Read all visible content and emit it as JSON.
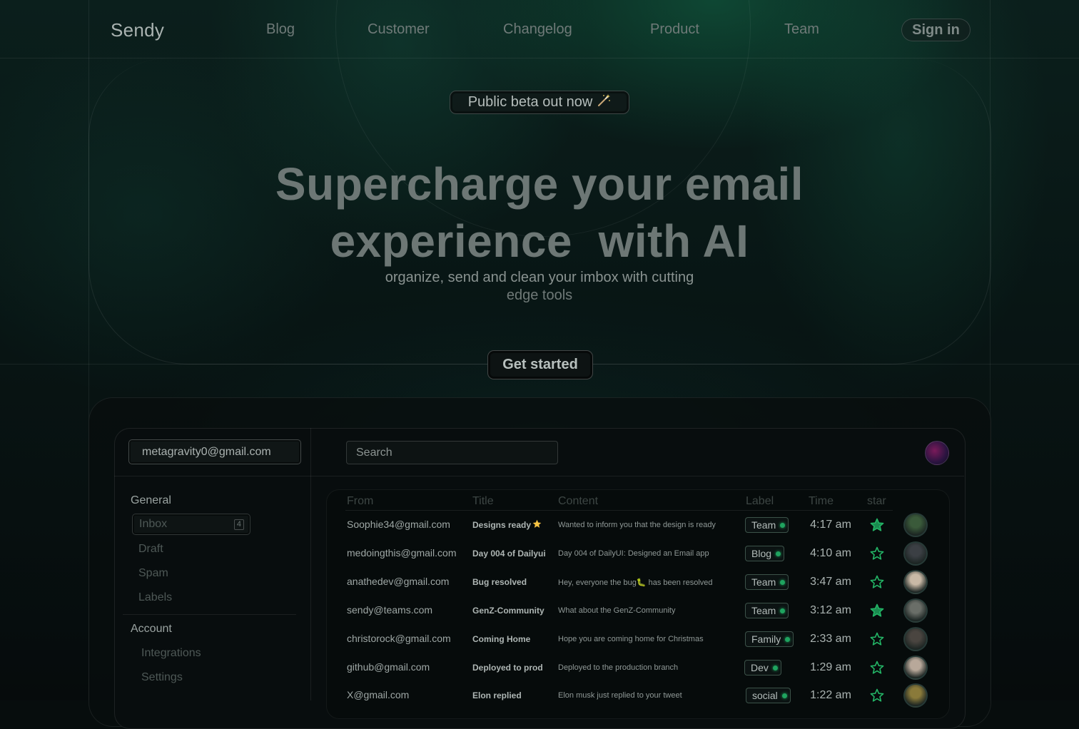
{
  "nav": {
    "brand": "Sendy",
    "links": [
      "Blog",
      "Customer",
      "Changelog",
      "Product",
      "Team"
    ],
    "signin": "Sign in"
  },
  "hero": {
    "pill_text": "Public beta out now",
    "pill_icon": "magic-wand-icon",
    "headline_line1": "Supercharge your email",
    "headline_line2": "experience  with AI",
    "subline_line1": "organize, send and clean your imbox with cutting",
    "subline_line2": "edge tools",
    "cta": "Get started"
  },
  "app": {
    "account_email": "metagravity0@gmail.com",
    "search_placeholder": "Search",
    "sidebar": {
      "general_title": "General",
      "inbox_label": "Inbox",
      "inbox_count": "4",
      "items": [
        "Draft",
        "Spam",
        "Labels"
      ],
      "account_title": "Account",
      "account_items": [
        "Integrations",
        "Settings"
      ]
    },
    "table": {
      "headers": [
        "From",
        "Title",
        "Content",
        "Label",
        "Time",
        "star"
      ],
      "rows": [
        {
          "from": "Soophie34@gmail.com",
          "title": "Designs ready",
          "title_icon": "star-emoji",
          "content": "Wanted to inform you that the design is ready",
          "label": "Team",
          "time": "4:17 am",
          "starred": true,
          "avatar_color": "#3a5a3a"
        },
        {
          "from": "medoingthis@gmail.com",
          "title": "Day 004 of Dailyui",
          "content": "Day 004 of DailyUI: Designed an Email app",
          "label": "Blog",
          "time": "4:10 am",
          "starred": false,
          "avatar_color": "#3b3f44"
        },
        {
          "from": "anathedev@gmail.com",
          "title": "Bug resolved",
          "content": "Hey,  everyone the bug🐛 has been resolved",
          "label": "Team",
          "time": "3:47 am",
          "starred": false,
          "avatar_color": "#c9b9a6"
        },
        {
          "from": "sendy@teams.com",
          "title": "GenZ-Community",
          "content": "What about the GenZ-Community",
          "label": "Team",
          "time": "3:12 am",
          "starred": true,
          "avatar_color": "#6a6e68"
        },
        {
          "from": "christorock@gmail.com",
          "title": "Coming Home",
          "content": "Hope you are coming home for Christmas",
          "label": "Family",
          "time": "2:33 am",
          "starred": false,
          "avatar_color": "#4a4540"
        },
        {
          "from": "github@gmail.com",
          "title": "Deployed to prod",
          "content": "Deployed to the production branch",
          "label": "Dev",
          "time": "1:29 am",
          "starred": false,
          "avatar_color": "#b8a89a"
        },
        {
          "from": "X@gmail.com",
          "title": "Elon replied",
          "content": "Elon musk just replied to your tweet",
          "label": "social",
          "time": "1:22 am",
          "starred": false,
          "avatar_color": "#8a7a3a"
        }
      ]
    }
  },
  "colors": {
    "accent_green": "#1fa35f",
    "background": "#070d0d"
  }
}
